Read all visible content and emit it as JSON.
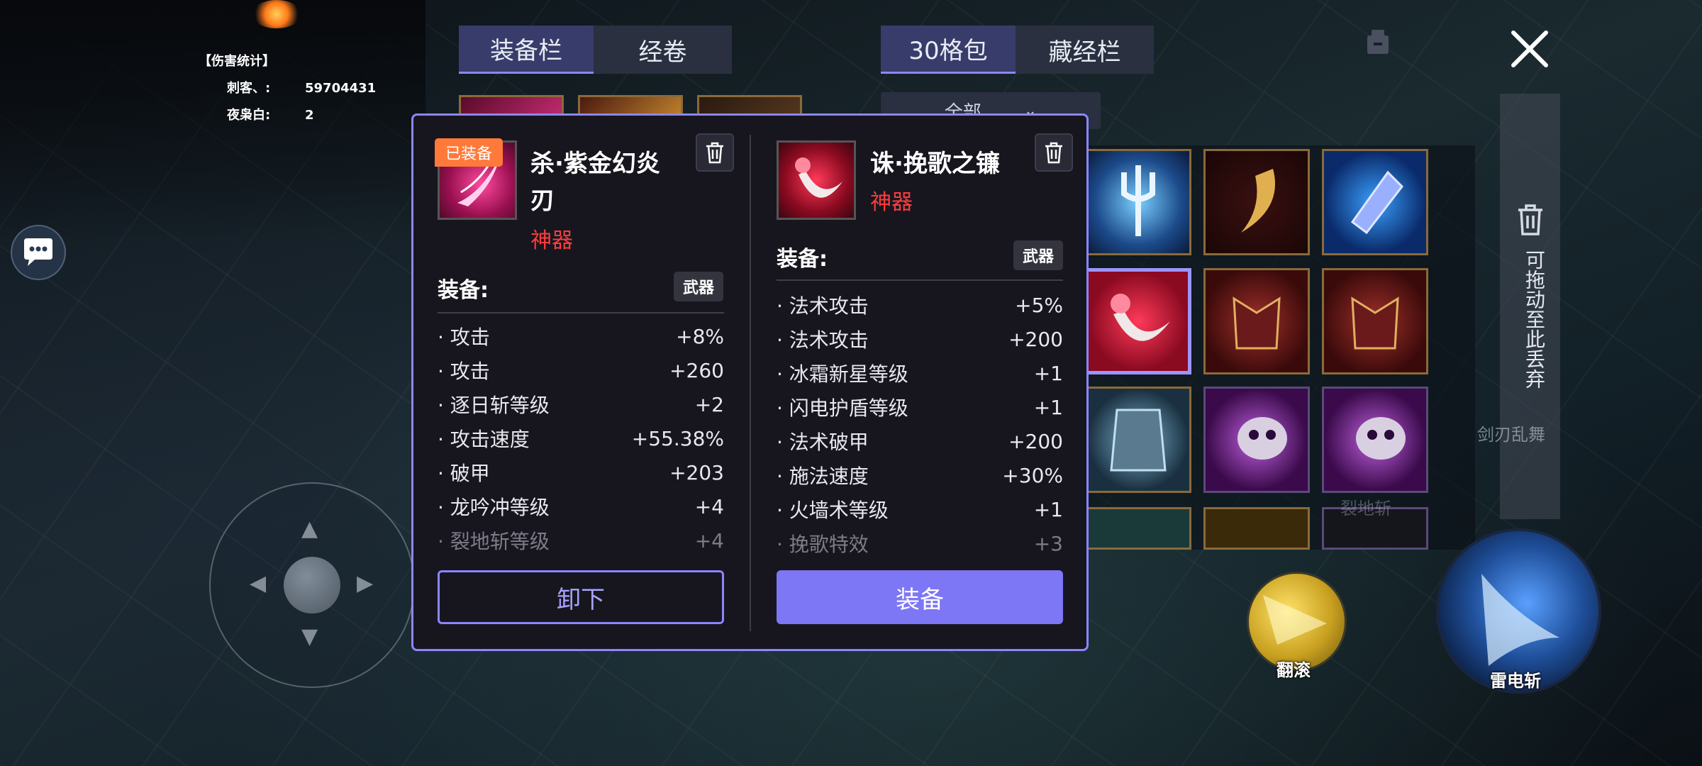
{
  "damage_stats": {
    "title": "【伤害统计】",
    "rows": [
      {
        "name": "刺客、:",
        "value": "59704431"
      },
      {
        "name": "夜枭白:",
        "value": "2"
      }
    ]
  },
  "tabs_left": [
    "装备栏",
    "经卷"
  ],
  "tabs_right": [
    "30格包",
    "藏经栏"
  ],
  "filter": {
    "label": "全部"
  },
  "discard_zone": {
    "label": "可拖动至此丢弃"
  },
  "bg_text": {
    "skill_hint": "剑刃乱舞",
    "partial": "裂地斩"
  },
  "skills": [
    {
      "label": "翻滚",
      "icon": "roll-skill-icon"
    },
    {
      "label": "雷电斩",
      "icon": "thunder-slash-skill-icon"
    }
  ],
  "compare": {
    "left": {
      "badge": "已装备",
      "name_line1": "杀·紫金幻炎",
      "name_line2": "刃",
      "rarity": "神器",
      "slot_label": "装备:",
      "slot_type": "武器",
      "attributes": [
        {
          "name": "· 攻击",
          "value": "+8%"
        },
        {
          "name": "· 攻击",
          "value": "+260"
        },
        {
          "name": "· 逐日斩等级",
          "value": "+2"
        },
        {
          "name": "· 攻击速度",
          "value": "+55.38%"
        },
        {
          "name": "· 破甲",
          "value": "+203"
        },
        {
          "name": "· 龙吟冲等级",
          "value": "+4"
        },
        {
          "name": "· 裂地斩等级",
          "value": "+4"
        }
      ],
      "button": "卸下"
    },
    "right": {
      "name": "诛·挽歌之镰",
      "rarity": "神器",
      "slot_label": "装备:",
      "slot_type": "武器",
      "attributes": [
        {
          "name": "· 法术攻击",
          "value": "+5%"
        },
        {
          "name": "· 法术攻击",
          "value": "+200"
        },
        {
          "name": "· 冰霜新星等级",
          "value": "+1"
        },
        {
          "name": "· 闪电护盾等级",
          "value": "+1"
        },
        {
          "name": "· 法术破甲",
          "value": "+200"
        },
        {
          "name": "· 施法速度",
          "value": "+30%"
        },
        {
          "name": "· 火墙术等级",
          "value": "+1"
        },
        {
          "name": "· 挽歌特效",
          "value": "+3"
        }
      ],
      "button": "装备"
    }
  },
  "colors": {
    "accent": "#8c86ff",
    "rarity": "#ff3c3c",
    "badge": "#ff7a3a",
    "equip_button": "#7d76f5"
  }
}
